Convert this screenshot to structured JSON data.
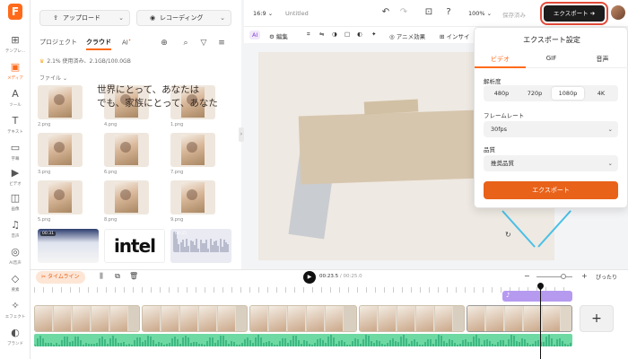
{
  "rail": {
    "logo": "F",
    "items": [
      {
        "label": "テンプレ...",
        "icon": "template-icon"
      },
      {
        "label": "メディア",
        "icon": "media-icon",
        "active": true
      },
      {
        "label": "ツール",
        "icon": "ai-tools-icon"
      },
      {
        "label": "テキスト",
        "icon": "text-icon"
      },
      {
        "label": "字幕",
        "icon": "subtitle-icon"
      },
      {
        "label": "ビデオ",
        "icon": "video-icon"
      },
      {
        "label": "画像",
        "icon": "image-icon"
      },
      {
        "label": "音声",
        "icon": "audio-icon"
      },
      {
        "label": "AI音声",
        "icon": "ai-voice-icon"
      },
      {
        "label": "要素",
        "icon": "elements-icon"
      },
      {
        "label": "エフェクト",
        "icon": "effects-icon"
      },
      {
        "label": "ブランド",
        "icon": "brand-icon"
      }
    ]
  },
  "panel": {
    "upload_label": "アップロード",
    "record_label": "レコーディング",
    "tabs": [
      "プロジェクト",
      "クラウド",
      "AI"
    ],
    "ai_badge": "✦",
    "usage": "2.1% 使用済み、2.1GB/100.0GB",
    "files_header": "ファイル",
    "images": [
      {
        "name": "2.png"
      },
      {
        "name": "4.png"
      },
      {
        "name": "1.png"
      },
      {
        "name": "3.png"
      },
      {
        "name": "6.png"
      },
      {
        "name": "7.png"
      },
      {
        "name": "5.png"
      },
      {
        "name": "8.png"
      },
      {
        "name": "9.png"
      }
    ],
    "videos": [
      {
        "duration": "00:31"
      },
      {
        "duration": "intel"
      },
      {
        "duration": "00:25"
      }
    ]
  },
  "topbar": {
    "aspect": "16:9",
    "title": "Untitled",
    "zoom": "100%",
    "save_status": "保存済み",
    "export_label": "エクスポート",
    "export_arrow": "➔"
  },
  "edit_toolbar": {
    "ai": "AI",
    "edit": "編集",
    "anime": "アニメ効果",
    "insight": "インサイ"
  },
  "canvas": {
    "quote_line1": "世界にとって、あなたは",
    "quote_line2": "でも、家族にとって、あなた"
  },
  "export_dialog": {
    "title": "エクスポート設定",
    "tabs": [
      "ビデオ",
      "GIF",
      "音声"
    ],
    "resolution_label": "解析度",
    "resolutions": [
      "480p",
      "720p",
      "1080p",
      "4K"
    ],
    "resolution_selected": "1080p",
    "framerate_label": "フレームレート",
    "framerate_value": "30fps",
    "quality_label": "品質",
    "quality_value": "推奨品質",
    "export_button": "エクスポート"
  },
  "timeline": {
    "timeline_label": "タイムライン",
    "current_time": "00:23.5",
    "total_time": "00:25.0",
    "fit_label": "ぴったり",
    "zoom_level": 0.75,
    "playhead_fraction": 0.94
  }
}
